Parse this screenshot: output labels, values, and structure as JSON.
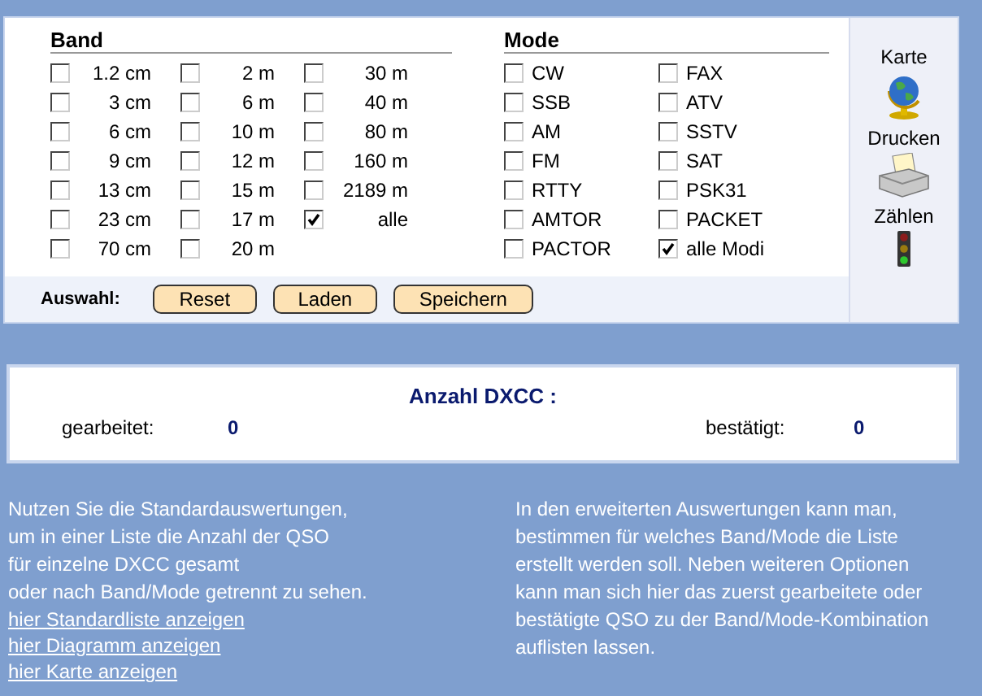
{
  "band": {
    "title": "Band",
    "columns": [
      [
        {
          "label": "1.2 cm",
          "checked": false
        },
        {
          "label": "3 cm",
          "checked": false
        },
        {
          "label": "6 cm",
          "checked": false
        },
        {
          "label": "9 cm",
          "checked": false
        },
        {
          "label": "13 cm",
          "checked": false
        },
        {
          "label": "23 cm",
          "checked": false
        },
        {
          "label": "70 cm",
          "checked": false
        }
      ],
      [
        {
          "label": "2 m",
          "checked": false
        },
        {
          "label": "6 m",
          "checked": false
        },
        {
          "label": "10 m",
          "checked": false
        },
        {
          "label": "12 m",
          "checked": false
        },
        {
          "label": "15 m",
          "checked": false
        },
        {
          "label": "17 m",
          "checked": false
        },
        {
          "label": "20 m",
          "checked": false
        }
      ],
      [
        {
          "label": "30 m",
          "checked": false
        },
        {
          "label": "40 m",
          "checked": false
        },
        {
          "label": "80 m",
          "checked": false
        },
        {
          "label": "160 m",
          "checked": false
        },
        {
          "label": "2189 m",
          "checked": false
        },
        {
          "label": "alle",
          "checked": true
        }
      ]
    ]
  },
  "mode": {
    "title": "Mode",
    "columns": [
      [
        {
          "label": "CW",
          "checked": false
        },
        {
          "label": "SSB",
          "checked": false
        },
        {
          "label": "AM",
          "checked": false
        },
        {
          "label": "FM",
          "checked": false
        },
        {
          "label": "RTTY",
          "checked": false
        },
        {
          "label": "AMTOR",
          "checked": false
        },
        {
          "label": "PACTOR",
          "checked": false
        }
      ],
      [
        {
          "label": "FAX",
          "checked": false
        },
        {
          "label": "ATV",
          "checked": false
        },
        {
          "label": "SSTV",
          "checked": false
        },
        {
          "label": "SAT",
          "checked": false
        },
        {
          "label": "PSK31",
          "checked": false
        },
        {
          "label": "PACKET",
          "checked": false
        },
        {
          "label": "alle Modi",
          "checked": true
        }
      ]
    ]
  },
  "selection": {
    "label": "Auswahl:",
    "buttons": [
      "Reset",
      "Laden",
      "Speichern"
    ]
  },
  "sidebar": [
    {
      "label": "Karte",
      "kind": "globe"
    },
    {
      "label": "Drucken",
      "kind": "printer"
    },
    {
      "label": "Zählen",
      "kind": "traffic"
    }
  ],
  "dxcc": {
    "title": "Anzahl DXCC :",
    "worked_label": "gearbeitet:",
    "worked": "0",
    "confirmed_label": "bestätigt:",
    "confirmed": "0"
  },
  "info_left": {
    "lines": [
      "Nutzen Sie die Standardauswertungen,",
      "um in einer Liste die Anzahl der QSO",
      "für einzelne DXCC gesamt",
      "oder nach Band/Mode getrennt zu sehen."
    ],
    "links": [
      "hier Standardliste anzeigen",
      "hier Diagramm anzeigen",
      "hier Karte anzeigen"
    ]
  },
  "info_right": {
    "lines": [
      "In den erweiterten Auswertungen kann man,",
      "bestimmen für welches Band/Mode die Liste",
      "erstellt werden soll. Neben weiteren Optionen",
      "kann man sich hier das zuerst gearbeitete oder",
      "bestätigte QSO zu der Band/Mode-Kombination",
      "auflisten lassen."
    ]
  }
}
